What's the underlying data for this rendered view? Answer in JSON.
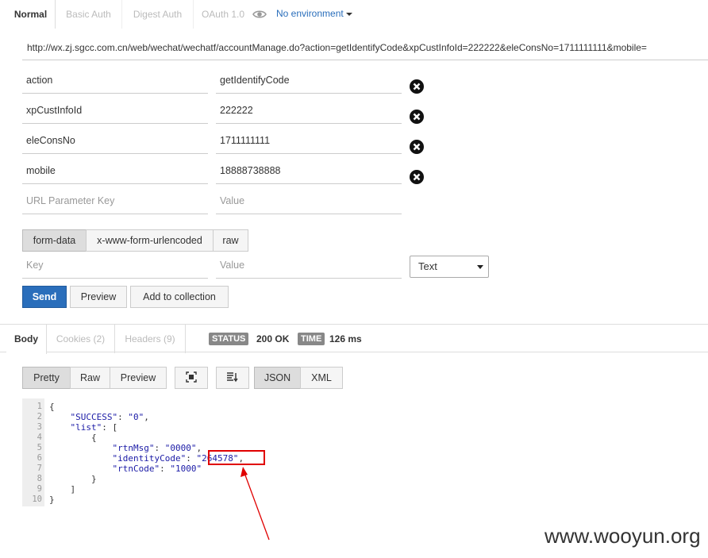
{
  "auth_tabs": [
    "Normal",
    "Basic Auth",
    "Digest Auth",
    "OAuth 1.0"
  ],
  "environment": {
    "label": "No environment"
  },
  "request": {
    "url": "http://wx.zj.sgcc.com.cn/web/wechat/wechatf/accountManage.do?action=getIdentifyCode&xpCustInfoId=222222&eleConsNo=1711111111&mobile="
  },
  "url_params": [
    {
      "key": "action",
      "value": "getIdentifyCode"
    },
    {
      "key": "xpCustInfoId",
      "value": "222222"
    },
    {
      "key": "eleConsNo",
      "value": "1711111111"
    },
    {
      "key": "mobile",
      "value": "18888738888"
    }
  ],
  "url_param_placeholder": {
    "key": "URL Parameter Key",
    "value": "Value"
  },
  "body_tabs": [
    "form-data",
    "x-www-form-urlencoded",
    "raw"
  ],
  "body_placeholder": {
    "key": "Key",
    "value": "Value"
  },
  "body_type": {
    "selected": "Text"
  },
  "actions": {
    "send": "Send",
    "preview": "Preview",
    "add": "Add to collection"
  },
  "response_tabs": [
    "Body",
    "Cookies (2)",
    "Headers (9)"
  ],
  "status": {
    "label": "STATUS",
    "value": "200 OK"
  },
  "time": {
    "label": "TIME",
    "value": "126 ms"
  },
  "view_modes": [
    "Pretty",
    "Raw",
    "Preview"
  ],
  "formats": [
    "JSON",
    "XML"
  ],
  "code_lines": [
    "{",
    "    \"SUCCESS\": \"0\",",
    "    \"list\": [",
    "        {",
    "            \"rtnMsg\": \"0000\",",
    "            \"identityCode\": \"264578\",",
    "            \"rtnCode\": \"1000\"",
    "        }",
    "    ]",
    "}"
  ],
  "line_numbers": [
    "1",
    "2",
    "3",
    "4",
    "5",
    "6",
    "7",
    "8",
    "9",
    "10"
  ],
  "watermark": "www.wooyun.org",
  "colors": {
    "accent": "#2a6ebb",
    "highlight": "#e00000"
  }
}
